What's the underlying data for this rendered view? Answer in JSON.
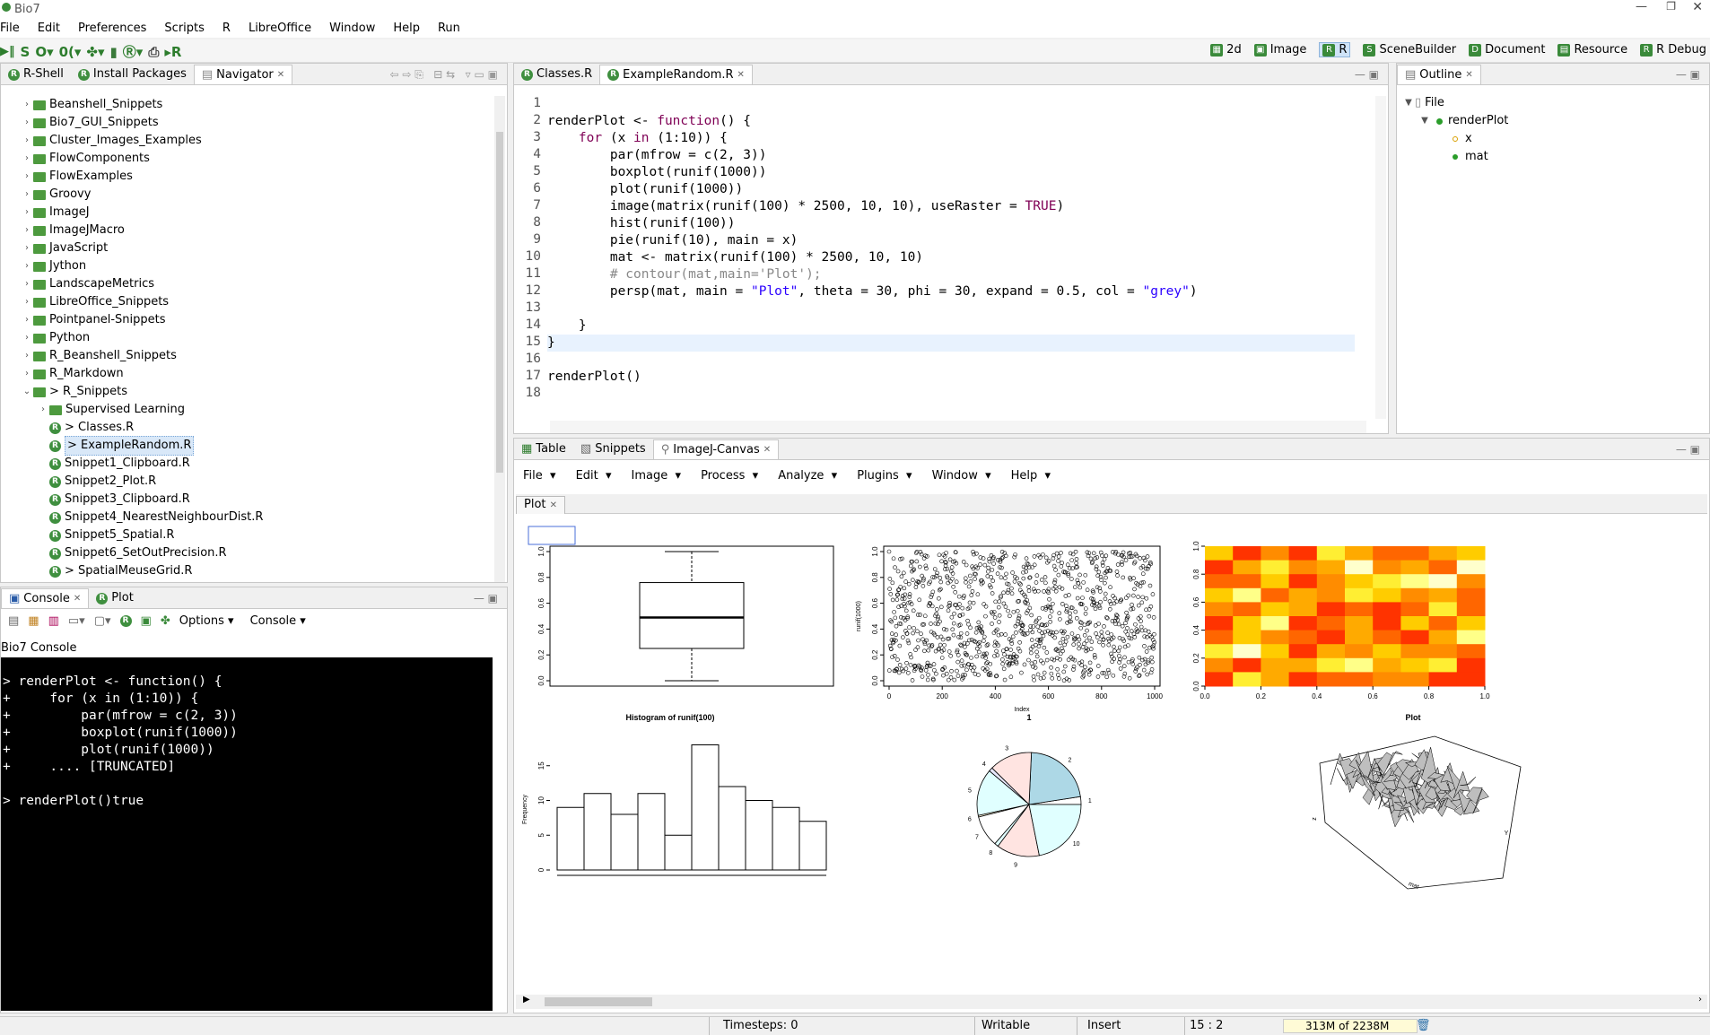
{
  "window": {
    "title": "Bio7"
  },
  "menu": [
    "File",
    "Edit",
    "Preferences",
    "Scripts",
    "R",
    "LibreOffice",
    "Window",
    "Help",
    "Run"
  ],
  "perspectives": [
    {
      "label": "2d",
      "active": false
    },
    {
      "label": "Image",
      "active": false
    },
    {
      "label": "R",
      "active": true
    },
    {
      "label": "SceneBuilder",
      "active": false
    },
    {
      "label": "Document",
      "active": false
    },
    {
      "label": "Resource",
      "active": false
    },
    {
      "label": "R Debug",
      "active": false
    }
  ],
  "left_tabs": [
    "R-Shell",
    "Install Packages",
    "Navigator"
  ],
  "navigator": [
    {
      "label": "Beanshell_Snippets",
      "type": "folder",
      "depth": 0,
      "expanded": false
    },
    {
      "label": "Bio7_GUI_Snippets",
      "type": "folder",
      "depth": 0,
      "expanded": false
    },
    {
      "label": "Cluster_Images_Examples",
      "type": "folder",
      "depth": 0,
      "expanded": false
    },
    {
      "label": "FlowComponents",
      "type": "folder",
      "depth": 0,
      "expanded": false
    },
    {
      "label": "FlowExamples",
      "type": "folder",
      "depth": 0,
      "expanded": false
    },
    {
      "label": "Groovy",
      "type": "folder",
      "depth": 0,
      "expanded": false
    },
    {
      "label": "ImageJ",
      "type": "folder",
      "depth": 0,
      "expanded": false
    },
    {
      "label": "ImageJMacro",
      "type": "folder",
      "depth": 0,
      "expanded": false
    },
    {
      "label": "JavaScript",
      "type": "folder",
      "depth": 0,
      "expanded": false
    },
    {
      "label": "Jython",
      "type": "folder",
      "depth": 0,
      "expanded": false
    },
    {
      "label": "LandscapeMetrics",
      "type": "folder",
      "depth": 0,
      "expanded": false
    },
    {
      "label": "LibreOffice_Snippets",
      "type": "folder",
      "depth": 0,
      "expanded": false
    },
    {
      "label": "Pointpanel-Snippets",
      "type": "folder",
      "depth": 0,
      "expanded": false
    },
    {
      "label": "Python",
      "type": "folder",
      "depth": 0,
      "expanded": false
    },
    {
      "label": "R_Beanshell_Snippets",
      "type": "folder",
      "depth": 0,
      "expanded": false
    },
    {
      "label": "R_Markdown",
      "type": "folder",
      "depth": 0,
      "expanded": false
    },
    {
      "label": "> R_Snippets",
      "type": "folder",
      "depth": 0,
      "expanded": true
    },
    {
      "label": "Supervised Learning",
      "type": "folder",
      "depth": 1,
      "expanded": false
    },
    {
      "label": "> Classes.R",
      "type": "r",
      "depth": 1
    },
    {
      "label": "> ExampleRandom.R",
      "type": "r",
      "depth": 1,
      "selected": true
    },
    {
      "label": "Snippet1_Clipboard.R",
      "type": "r",
      "depth": 1
    },
    {
      "label": "Snippet2_Plot.R",
      "type": "r",
      "depth": 1
    },
    {
      "label": "Snippet3_Clipboard.R",
      "type": "r",
      "depth": 1
    },
    {
      "label": "Snippet4_NearestNeighbourDist.R",
      "type": "r",
      "depth": 1
    },
    {
      "label": "Snippet5_Spatial.R",
      "type": "r",
      "depth": 1
    },
    {
      "label": "Snippet6_SetOutPrecision.R",
      "type": "r",
      "depth": 1
    },
    {
      "label": "> SpatialMeuseGrid.R",
      "type": "r",
      "depth": 1
    }
  ],
  "editor_tabs": [
    "Classes.R",
    "ExampleRandom.R"
  ],
  "code": [
    "",
    "renderPlot <- function() {",
    "    for (x in (1:10)) {",
    "        par(mfrow = c(2, 3))",
    "        boxplot(runif(1000))",
    "        plot(runif(1000))",
    "        image(matrix(runif(100) * 2500, 10, 10), useRaster = TRUE)",
    "        hist(runif(100))",
    "        pie(runif(10), main = x)",
    "        mat <- matrix(runif(100) * 2500, 10, 10)",
    "        # contour(mat,main='Plot');",
    "        persp(mat, main = \"Plot\", theta = 30, phi = 30, expand = 0.5, col = \"grey\")",
    "",
    "    }",
    "}",
    "",
    "renderPlot()",
    ""
  ],
  "outline": {
    "tab": "Outline",
    "root": "File",
    "fn": "renderPlot",
    "vars": [
      "x",
      "mat"
    ]
  },
  "console_tabs": [
    "Console",
    "Plot"
  ],
  "console_toolbar": {
    "options": "Options",
    "console": "Console"
  },
  "console_title": "Bio7 Console",
  "console_lines": [
    "> renderPlot <- function() {",
    "+     for (x in (1:10)) {",
    "+         par(mfrow = c(2, 3))",
    "+         boxplot(runif(1000))",
    "+         plot(runif(1000))",
    "+     .... [TRUNCATED]",
    "",
    "> renderPlot()true"
  ],
  "bottom_tabs": [
    "Table",
    "Snippets",
    "ImageJ-Canvas"
  ],
  "ij_menu": [
    "File",
    "Edit",
    "Image",
    "Process",
    "Analyze",
    "Plugins",
    "Window",
    "Help"
  ],
  "plot_tab": "Plot",
  "plots": {
    "hist_title": "Histogram of runif(100)",
    "pie_title": "1",
    "persp_title": "Plot",
    "scatter_ylabel": "runif(1000)",
    "scatter_xlabel": "Index",
    "hist_ylabel": "Frequency",
    "persp_zlabel": "z",
    "persp_xlabel": "mat",
    "persp_ylabel": "Y"
  },
  "chart_data": [
    {
      "type": "boxplot",
      "title": "",
      "yticks": [
        "0.0",
        "0.2",
        "0.4",
        "0.6",
        "0.8",
        "1.0"
      ],
      "stats": {
        "min": 0.0,
        "q1": 0.25,
        "median": 0.49,
        "q3": 0.76,
        "max": 1.0
      }
    },
    {
      "type": "scatter",
      "title": "",
      "xlabel": "Index",
      "ylabel": "runif(1000)",
      "xticks": [
        "0",
        "200",
        "400",
        "600",
        "800",
        "1000"
      ],
      "yticks": [
        "0.0",
        "0.2",
        "0.4",
        "0.6",
        "0.8",
        "1.0"
      ],
      "n": 1000
    },
    {
      "type": "heatmap",
      "title": "",
      "xticks": [
        "0.0",
        "0.2",
        "0.4",
        "0.6",
        "0.8",
        "1.0"
      ],
      "yticks": [
        "0.0",
        "0.2",
        "0.4",
        "0.6",
        "0.8",
        "1.0"
      ],
      "values": [
        [
          5,
          1,
          3,
          1,
          6,
          4,
          2,
          2,
          4,
          5
        ],
        [
          1,
          4,
          6,
          3,
          4,
          8,
          3,
          4,
          2,
          8
        ],
        [
          2,
          2,
          5,
          1,
          3,
          5,
          6,
          7,
          8,
          3
        ],
        [
          5,
          7,
          2,
          4,
          3,
          6,
          5,
          3,
          4,
          2
        ],
        [
          3,
          2,
          5,
          4,
          1,
          2,
          1,
          2,
          6,
          2
        ],
        [
          1,
          5,
          7,
          1,
          2,
          4,
          1,
          5,
          2,
          5
        ],
        [
          2,
          5,
          3,
          2,
          1,
          4,
          2,
          1,
          4,
          7
        ],
        [
          6,
          8,
          5,
          1,
          4,
          3,
          5,
          3,
          3,
          2
        ],
        [
          3,
          1,
          4,
          4,
          6,
          7,
          4,
          5,
          6,
          1
        ],
        [
          1,
          6,
          4,
          1,
          2,
          2,
          3,
          3,
          1,
          1
        ]
      ]
    },
    {
      "type": "bar",
      "title": "Histogram of runif(100)",
      "ylabel": "Frequency",
      "yticks": [
        "0",
        "5",
        "10",
        "15"
      ],
      "values": [
        9,
        11,
        8,
        11,
        5,
        18,
        12,
        10,
        9,
        7
      ]
    },
    {
      "type": "pie",
      "title": "1",
      "labels": [
        "1",
        "2",
        "3",
        "4",
        "5",
        "6",
        "7",
        "8",
        "9",
        "10"
      ],
      "values": [
        0.1,
        0.9,
        0.55,
        0.05,
        0.6,
        0.02,
        0.4,
        0.05,
        0.55,
        0.9
      ]
    },
    {
      "type": "surface",
      "title": "Plot",
      "xlabel": "mat",
      "ylabel": "Y",
      "zlabel": "z"
    }
  ],
  "status": {
    "timesteps": "Timesteps: 0",
    "mode": "Writable",
    "insert": "Insert",
    "pos": "15 : 2",
    "memory": "313M of 2238M"
  }
}
